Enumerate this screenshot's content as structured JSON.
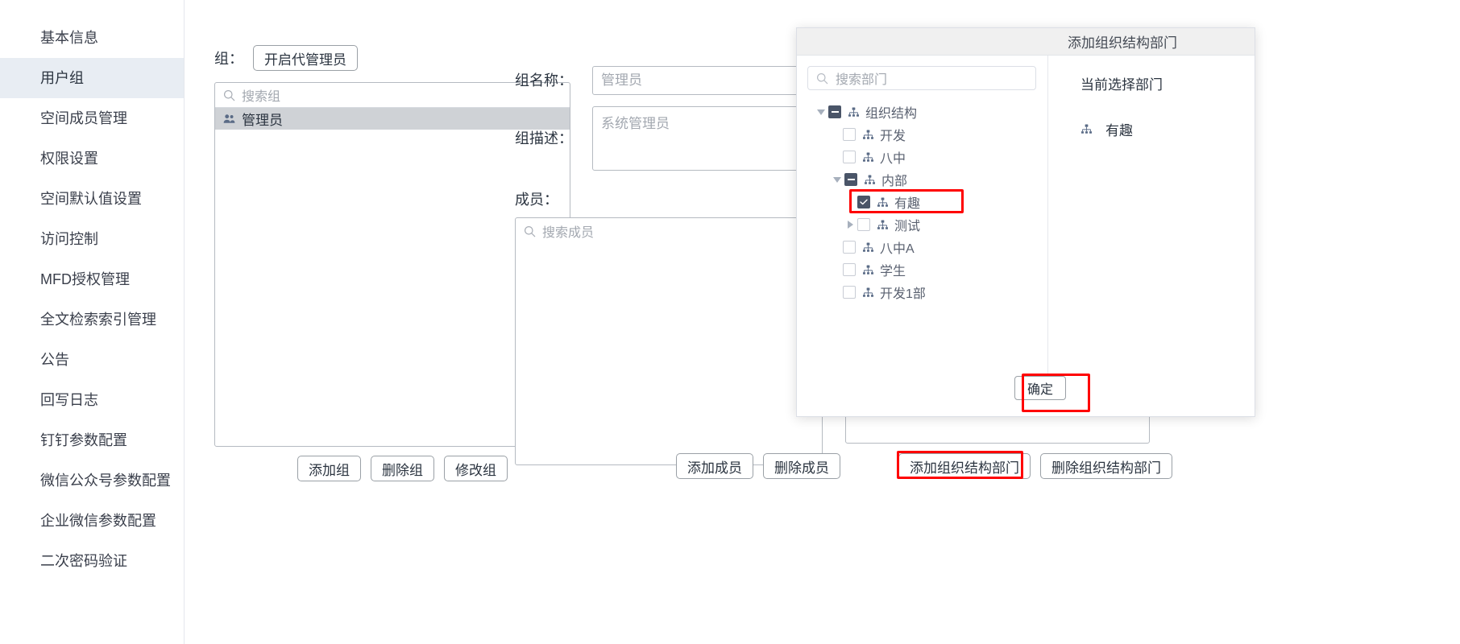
{
  "sidebar": {
    "items": [
      {
        "label": "基本信息",
        "active": false
      },
      {
        "label": "用户组",
        "active": true
      },
      {
        "label": "空间成员管理",
        "active": false
      },
      {
        "label": "权限设置",
        "active": false
      },
      {
        "label": "空间默认值设置",
        "active": false
      },
      {
        "label": "访问控制",
        "active": false
      },
      {
        "label": "MFD授权管理",
        "active": false
      },
      {
        "label": "全文检索索引管理",
        "active": false
      },
      {
        "label": "公告",
        "active": false
      },
      {
        "label": "回写日志",
        "active": false
      },
      {
        "label": "钉钉参数配置",
        "active": false
      },
      {
        "label": "微信公众号参数配置",
        "active": false
      },
      {
        "label": "企业微信参数配置",
        "active": false
      },
      {
        "label": "二次密码验证",
        "active": false
      }
    ]
  },
  "groups_panel": {
    "label": "组：",
    "proxy_admin_button": "开启代管理员",
    "search_placeholder": "搜索组",
    "items": [
      {
        "label": "管理员",
        "selected": true
      }
    ],
    "buttons": [
      "添加组",
      "删除组",
      "修改组"
    ]
  },
  "detail_panel": {
    "group_name_label": "组名称：",
    "group_name_value": "管理员",
    "group_desc_label": "组描述：",
    "group_desc_value": "系统管理员",
    "members_label": "成员：",
    "members_search_placeholder": "搜索成员",
    "buttons": [
      "添加成员",
      "删除成员"
    ]
  },
  "dept_panel": {
    "buttons": [
      "添加组织结构部门",
      "删除组织结构部门"
    ]
  },
  "modal": {
    "title": "添加组织结构部门",
    "search_placeholder": "搜索部门",
    "tree": [
      {
        "label": "组织结构",
        "depth": 0,
        "caret": "down",
        "check": "indeterminate",
        "highlight": false
      },
      {
        "label": "开发",
        "depth": 1,
        "caret": "none",
        "check": "unchecked",
        "highlight": false
      },
      {
        "label": "八中",
        "depth": 1,
        "caret": "none",
        "check": "unchecked",
        "highlight": false
      },
      {
        "label": "内部",
        "depth": 1,
        "caret": "down",
        "check": "indeterminate",
        "highlight": false
      },
      {
        "label": "有趣",
        "depth": 2,
        "caret": "none",
        "check": "checked",
        "highlight": true
      },
      {
        "label": "测试",
        "depth": 2,
        "caret": "right",
        "check": "unchecked",
        "highlight": false
      },
      {
        "label": "八中A",
        "depth": 1,
        "caret": "none",
        "check": "unchecked",
        "highlight": false
      },
      {
        "label": "学生",
        "depth": 1,
        "caret": "none",
        "check": "unchecked",
        "highlight": false
      },
      {
        "label": "开发1部",
        "depth": 1,
        "caret": "none",
        "check": "unchecked",
        "highlight": false
      }
    ],
    "right_title": "当前选择部门",
    "selected_dept": "有趣",
    "confirm_label": "确定"
  },
  "colors": {
    "annotation": "#ff0000",
    "sidebar_active_bg": "#e8edf3",
    "list_selected_bg": "#cfd2d6",
    "tree_checked": "#4a5568"
  }
}
